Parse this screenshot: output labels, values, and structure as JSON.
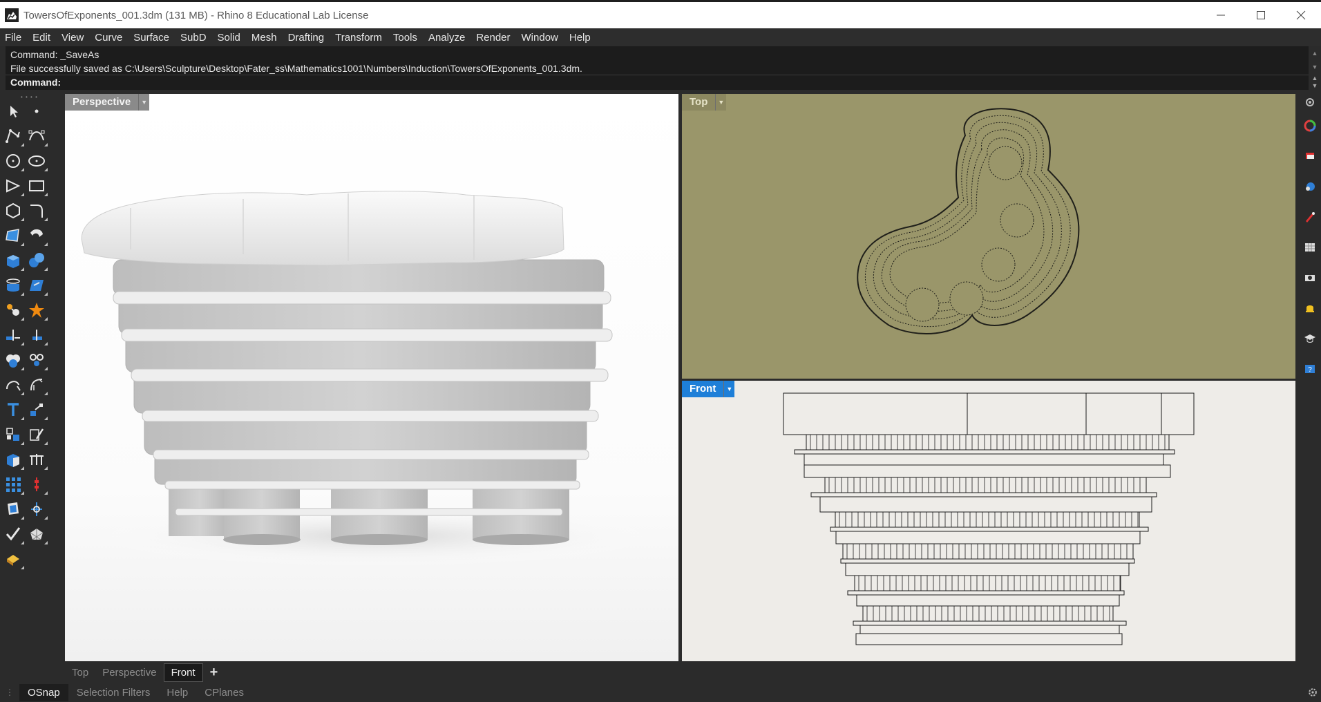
{
  "window": {
    "title": "TowersOfExponents_001.3dm (131 MB) - Rhino 8 Educational Lab License",
    "app_icon": "rhino-icon",
    "controls": [
      "minimize-icon",
      "maximize-icon",
      "close-icon"
    ]
  },
  "menu": [
    "File",
    "Edit",
    "View",
    "Curve",
    "Surface",
    "SubD",
    "Solid",
    "Mesh",
    "Drafting",
    "Transform",
    "Tools",
    "Analyze",
    "Render",
    "Window",
    "Help"
  ],
  "command": {
    "history": [
      "Command: _SaveAs",
      "File successfully saved as C:\\Users\\Sculpture\\Desktop\\Fater_ss\\Mathematics1001\\Numbers\\Induction\\TowersOfExponents_001.3dm."
    ],
    "prompt": "Command:"
  },
  "viewports": {
    "perspective": {
      "label": "Perspective"
    },
    "top": {
      "label": "Top"
    },
    "front": {
      "label": "Front",
      "active": true
    }
  },
  "viewport_tabs": {
    "items": [
      "Top",
      "Perspective",
      "Front"
    ],
    "active": "Front",
    "add_label": "+"
  },
  "status_bar": {
    "items": [
      "OSnap",
      "Selection Filters",
      "Help",
      "CPlanes"
    ],
    "active": "OSnap"
  },
  "colors": {
    "accent": "#1e7fd8",
    "top_viewport_bg": "#9a966a",
    "front_viewport_bg": "#eeece8",
    "chrome_dark": "#2b2b2b"
  },
  "toolbar_icons": [
    "select-arrow-icon",
    "point-icon",
    "polyline-icon",
    "curve-cv-icon",
    "circle-icon",
    "ellipse-icon",
    "arc-icon",
    "rectangle-icon",
    "polygon-icon",
    "fillet-curve-icon",
    "surface-from-points-icon",
    "sweep-icon",
    "box-icon",
    "sphere-icon",
    "extrude-icon",
    "plane-surface-icon",
    "solid-tools-icon",
    "explode-icon",
    "trim-icon",
    "split-icon",
    "boolean-union-icon",
    "boolean-split-icon",
    "blend-icon",
    "fillet-edge-icon",
    "text-icon",
    "dimension-icon",
    "group-icon",
    "edit-icon",
    "block-icon",
    "array-icon",
    "grid-array-icon",
    "gumball-icon",
    "layer-icon",
    "analyze-icon",
    "check-icon",
    "mesh-icon",
    "render-icon"
  ],
  "right_panel_icons": [
    "gear-icon",
    "color-wheel-icon",
    "layers-icon",
    "materials-icon",
    "lights-icon",
    "grid-icon",
    "camera-icon",
    "notifications-icon",
    "learn-icon",
    "help-icon"
  ]
}
